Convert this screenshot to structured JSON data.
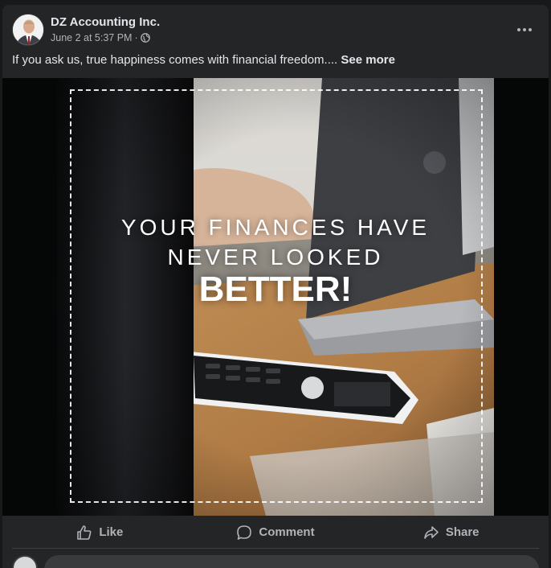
{
  "post": {
    "author": "DZ Accounting Inc.",
    "timestamp": "June 2 at 5:37 PM",
    "separator": "·",
    "privacy_icon": "globe-icon",
    "caption": "If you ask us, true happiness comes with financial freedom....",
    "see_more": "See more"
  },
  "image_text": {
    "line1": "YOUR FINANCES HAVE",
    "line2": "NEVER LOOKED",
    "line3": "BETTER!"
  },
  "actions": {
    "like": "Like",
    "comment": "Comment",
    "share": "Share"
  },
  "colors": {
    "card_bg": "#242526",
    "text_primary": "#e4e6eb",
    "text_secondary": "#b0b3b8"
  }
}
